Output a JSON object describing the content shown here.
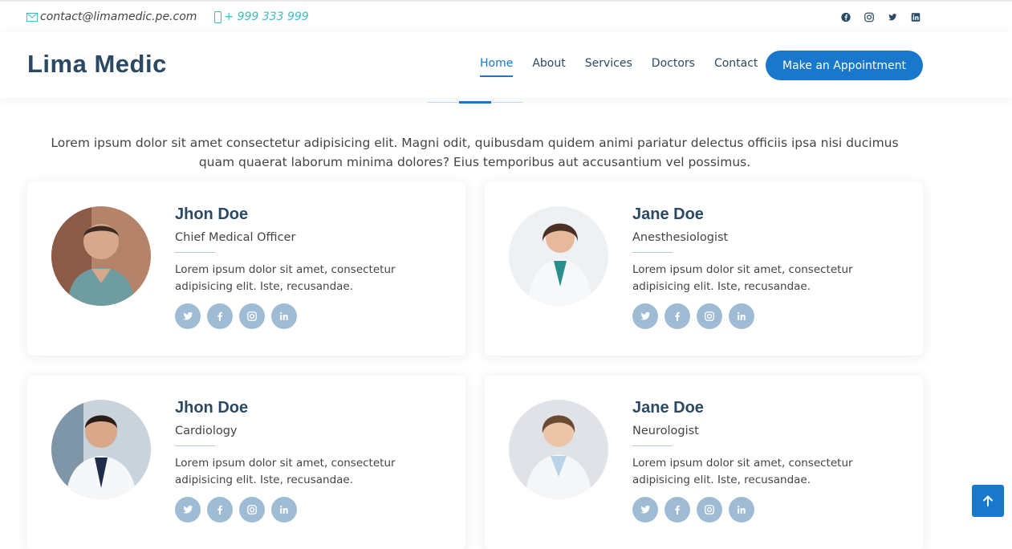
{
  "topbar": {
    "email": "contact@limamedic.pe.com",
    "phone": "+ 999 333 999",
    "social_icons": [
      "facebook-icon",
      "instagram-icon",
      "twitter-icon",
      "linkedin-icon"
    ]
  },
  "header": {
    "logo": "Lima Medic",
    "nav": [
      "Home",
      "About",
      "Services",
      "Doctors",
      "Contact"
    ],
    "active_nav": "Home",
    "cta": "Make an Appointment"
  },
  "section": {
    "intro": "Lorem ipsum dolor sit amet consectetur adipisicing elit. Magni odit, quibusdam quidem animi pariatur delectus officiis ipsa nisi ducimus quam quaerat laborum minima dolores? Eius temporibus aut accusantium vel possimus."
  },
  "doctors": [
    {
      "name": "Jhon Doe",
      "role": "Chief Medical Officer",
      "desc": "Lorem ipsum dolor sit amet, consectetur adipisicing elit. Iste, recusandae."
    },
    {
      "name": "Jane Doe",
      "role": "Anesthesiologist",
      "desc": "Lorem ipsum dolor sit amet, consectetur adipisicing elit. Iste, recusandae."
    },
    {
      "name": "Jhon Doe",
      "role": "Cardiology",
      "desc": "Lorem ipsum dolor sit amet, consectetur adipisicing elit. Iste, recusandae."
    },
    {
      "name": "Jane Doe",
      "role": "Neurologist",
      "desc": "Lorem ipsum dolor sit amet, consectetur adipisicing elit. Iste, recusandae."
    }
  ],
  "card_social_icons": [
    "twitter-icon",
    "facebook-icon",
    "instagram-icon",
    "linkedin-icon"
  ],
  "colors": {
    "primary": "#1977cc",
    "heading": "#2c4964",
    "accent": "#3fbbc0",
    "social_bg": "#a0bcd5"
  }
}
